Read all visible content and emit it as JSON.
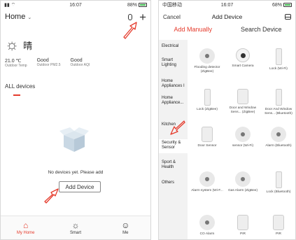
{
  "left": {
    "status": {
      "time": "16:07",
      "battery": "88%"
    },
    "header": {
      "title": "Home"
    },
    "weather": {
      "condition": "晴"
    },
    "stats": [
      {
        "value": "21.0 ℃",
        "label": "Outdoor Temp"
      },
      {
        "value": "Good",
        "label": "Outdoor PM2.5"
      },
      {
        "value": "Good",
        "label": "Outdoor AQI"
      }
    ],
    "section_label": "ALL devices",
    "empty_message": "No devices yet. Please add",
    "add_device_label": "Add Device",
    "tabs": [
      {
        "label": "My Home",
        "icon": "home-icon"
      },
      {
        "label": "Smart",
        "icon": "sun-icon"
      },
      {
        "label": "Me",
        "icon": "user-icon"
      }
    ]
  },
  "right": {
    "status": {
      "carrier": "中国移动",
      "time": "16:07",
      "battery": "68%"
    },
    "header": {
      "cancel_label": "Cancel",
      "title": "Add Device"
    },
    "mode_tabs": [
      "Add Manually",
      "Search Device"
    ],
    "categories": [
      {
        "label": "Electrical"
      },
      {
        "label": "Smart Lighting"
      },
      {
        "label": "Home Appliances I"
      },
      {
        "label": "Home Appliance..."
      },
      {
        "label": "Kitchen"
      },
      {
        "label": "Security & Sensor"
      },
      {
        "label": "Sport & Health"
      },
      {
        "label": "Others"
      }
    ],
    "devices": [
      {
        "label": "Flooding detector (ZigBee)",
        "icon": "flood-sensor-icon"
      },
      {
        "label": "Smart Camera",
        "icon": "camera-icon"
      },
      {
        "label": "Lock (Wi-Fi)",
        "icon": "lock-icon"
      },
      {
        "label": "Lock (ZigBee)",
        "icon": "lock-icon"
      },
      {
        "label": "Door and Window Sens... (ZigBee)",
        "icon": "door-sensor-icon"
      },
      {
        "label": "Door And Window Sens... (Bluetooth)",
        "icon": "door-sensor-icon"
      },
      {
        "label": "Door Sensor",
        "icon": "door-sensor-icon"
      },
      {
        "label": "sensor (Wi-Fi)",
        "icon": "sensor-icon"
      },
      {
        "label": "Alarm (Bluetooth)",
        "icon": "alarm-icon"
      },
      {
        "label": "Alarm system (Wi-F...",
        "icon": "alarm-icon"
      },
      {
        "label": "Gas Alarm (ZigBee)",
        "icon": "gas-alarm-icon"
      },
      {
        "label": "Lock (Bluetooth)",
        "icon": "lock-icon"
      },
      {
        "label": "CO Alarm",
        "icon": "co-alarm-icon"
      },
      {
        "label": "PIR",
        "icon": "pir-sensor-icon"
      },
      {
        "label": "PIR",
        "icon": "pir-sensor-icon"
      }
    ]
  },
  "colors": {
    "accent": "#e53b2c",
    "arrow": "#e53b2c"
  }
}
